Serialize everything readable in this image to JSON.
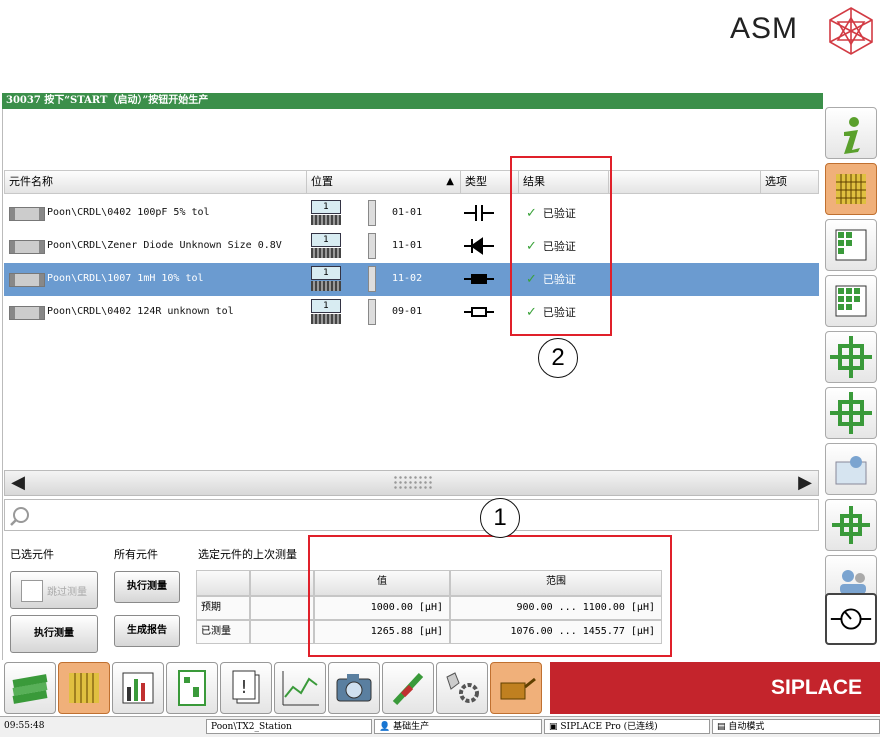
{
  "brand": {
    "logo_text": "ASM",
    "siplace_text": "SIPLACE"
  },
  "title": "30037 按下“START（启动）”按钮开始生产",
  "table": {
    "headers": {
      "name": "元件名称",
      "position": "位置",
      "type": "类型",
      "result": "结果",
      "options": "选项"
    },
    "rows": [
      {
        "name": "Poon\\CRDL\\0402 100pF 5% tol",
        "feeder": "1",
        "slot": "01-01",
        "symbol": "capacitor-symbol-icon",
        "result": "已验证",
        "selected": false
      },
      {
        "name": "Poon\\CRDL\\Zener Diode Unknown Size 0.8V",
        "feeder": "1",
        "slot": "11-01",
        "symbol": "diode-symbol-icon",
        "result": "已验证",
        "selected": false
      },
      {
        "name": "Poon\\CRDL\\1007 1mH 10% tol",
        "feeder": "1",
        "slot": "11-02",
        "symbol": "inductor-symbol-icon",
        "result": "已验证",
        "selected": true
      },
      {
        "name": "Poon\\CRDL\\0402 124R unknown tol",
        "feeder": "1",
        "slot": "09-01",
        "symbol": "resistor-symbol-icon",
        "result": "已验证",
        "selected": false
      }
    ]
  },
  "callouts": {
    "one": "1",
    "two": "2"
  },
  "bottom_panel": {
    "selected_components": "已选元件",
    "all_components": "所有元件",
    "last_measurement": "选定元件的上次测量",
    "skip_button": "跳过测量",
    "execute_measure_top": "执行测量",
    "execute_measure": "执行测量",
    "generate_report": "生成报告",
    "measure_headers": {
      "value": "值",
      "range": "范围"
    },
    "expected": {
      "label": "预期",
      "value": "1000.00 [μH]",
      "range": "900.00 ... 1100.00 [μH]"
    },
    "measured": {
      "label": "已测量",
      "value": "1265.88 [μH]",
      "range": "1076.00 ... 1455.77 [μH]"
    }
  },
  "status_bar": {
    "time": "09:55:48",
    "station": "Poon\\TX2_Station",
    "mode": "基础生产",
    "software": "SIPLACE Pro (已连线)",
    "auto": "自动模式"
  },
  "colors": {
    "title_green": "#3b8f4a",
    "selection_blue": "#6b9bd0",
    "siplace_red": "#c4242c",
    "highlight_red": "#e0202a"
  }
}
